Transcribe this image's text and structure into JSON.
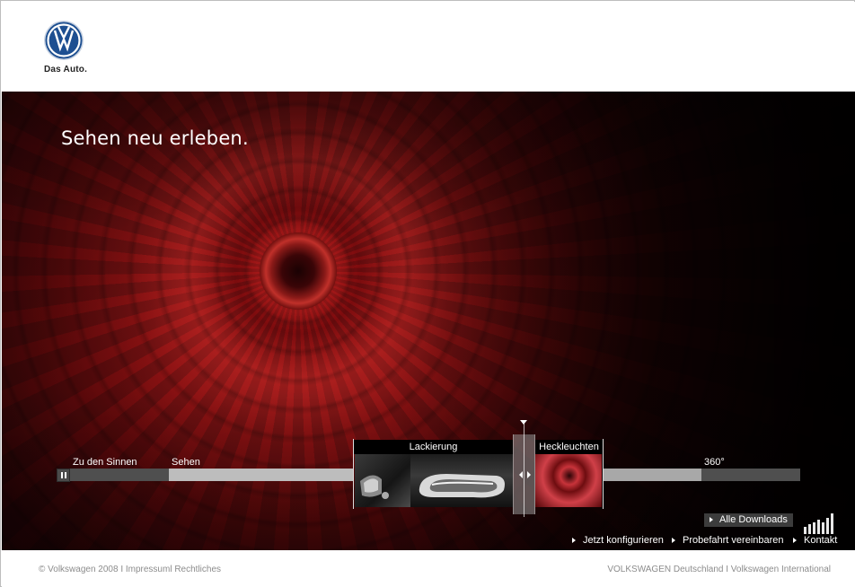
{
  "brand": {
    "tagline": "Das Auto.",
    "logo_icon": "vw-logo-icon",
    "accent": "#1d4f91"
  },
  "hero": {
    "headline": "Sehen neu erleben."
  },
  "timeline": {
    "labels": {
      "start": "Zu den Sinnen",
      "current": "Sehen",
      "end": "360°"
    },
    "preview_titles": [
      "Lackierung",
      "Heckleuchten"
    ],
    "pause_icon": "pause-icon",
    "handle_icon": "scrub-handle-icon"
  },
  "actions": {
    "downloads": "Alle Downloads",
    "links": [
      "Jetzt konfigurieren",
      "Probefahrt vereinbaren",
      "Kontakt"
    ],
    "volume_icon": "volume-bars-icon"
  },
  "footer": {
    "left": "© Volkswagen 2008 I Impressuml Rechtliches",
    "right": "VOLKSWAGEN Deutschland I Volkswagen International"
  }
}
